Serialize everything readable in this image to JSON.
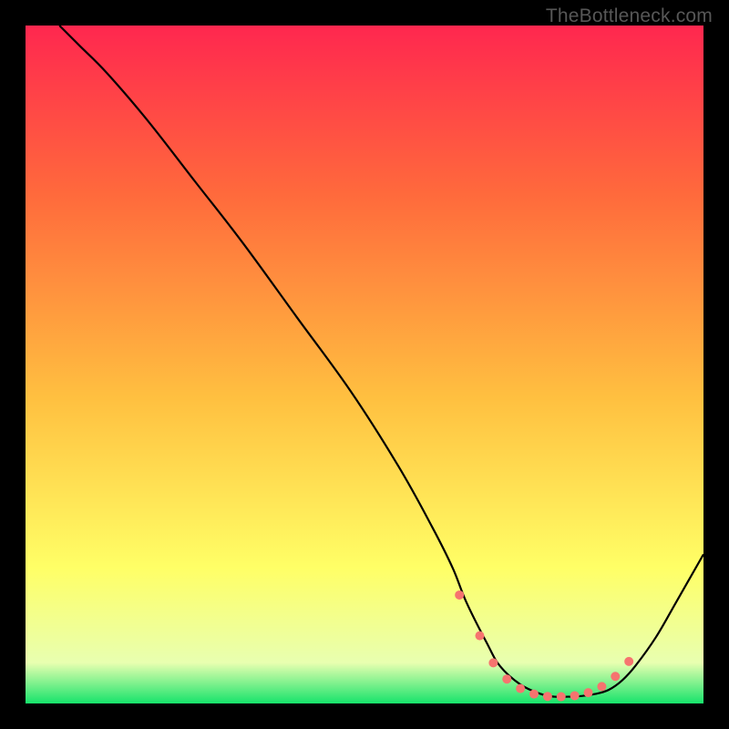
{
  "watermark": "TheBottleneck.com",
  "colors": {
    "gradient": [
      "#ff274f",
      "#ff6a3c",
      "#ffc040",
      "#ffff66",
      "#e8ffb0",
      "#17e36b"
    ],
    "curve": "#000000",
    "dot_fill": "#f6746f",
    "dot_stroke": "#c24a46"
  },
  "chart_data": {
    "type": "line",
    "title": "",
    "xlabel": "",
    "ylabel": "",
    "xlim": [
      0,
      100
    ],
    "ylim": [
      0,
      100
    ],
    "grid": false,
    "legend": false,
    "series": [
      {
        "name": "curve",
        "x": [
          5,
          8,
          12,
          18,
          25,
          32,
          40,
          48,
          55,
          60,
          63,
          65,
          68,
          70,
          73,
          76,
          78,
          80,
          82,
          84,
          86,
          88,
          90,
          93,
          96,
          100
        ],
        "y": [
          100,
          97,
          93,
          86,
          77,
          68,
          57,
          46,
          35,
          26,
          20,
          15,
          9,
          5.5,
          2.8,
          1.4,
          1,
          1,
          1.1,
          1.4,
          2,
          3.4,
          5.6,
          9.8,
          15,
          22
        ]
      }
    ],
    "dots": {
      "x": [
        64,
        67,
        69,
        71,
        73,
        75,
        77,
        79,
        81,
        83,
        85,
        87,
        89
      ],
      "y": [
        16,
        10,
        6,
        3.6,
        2.2,
        1.4,
        1.05,
        1.0,
        1.15,
        1.6,
        2.5,
        4.0,
        6.2
      ]
    }
  }
}
